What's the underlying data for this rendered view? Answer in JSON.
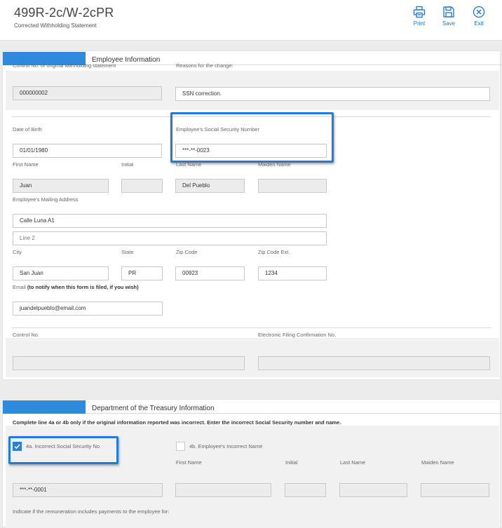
{
  "header": {
    "title": "499R-2c/W-2cPR",
    "subtitle": "Corrected Withholding Statement",
    "print_label": "Print",
    "save_label": "Save",
    "exit_label": "Exit"
  },
  "employee_section": {
    "title": "Employee Information",
    "control_no_original_label": "Control No. of original withholding statement",
    "control_no_original_value": "000000002",
    "reasons_label": "Reasons for the change:",
    "reasons_value": "SSN correction.",
    "dob_label": "Date of Birth",
    "dob_value": "01/01/1980",
    "ssn_label": "Employee's Social Security Number",
    "ssn_value": "***-**-0023",
    "first_name_label": "First Name",
    "first_name_value": "Juan",
    "initial_label": "Initial",
    "initial_value": "",
    "last_name_label": "Last Name",
    "last_name_value": "Del Pueblo",
    "maiden_name_label": "Maiden Name",
    "maiden_name_value": "",
    "mailing_address_label": "Employee's Mailing Address",
    "address_line1_value": "Calle Luna A1",
    "address_line2_placeholder": "Line 2",
    "city_label": "City",
    "city_value": "San Juan",
    "state_label": "State",
    "state_value": "PR",
    "zip_label": "Zip Code",
    "zip_value": "00923",
    "zip_ext_label": "Zip Code Ext.",
    "zip_ext_value": "1234",
    "email_label_prefix": "Email",
    "email_label_note": "(to notify when this form is filed, if you wish)",
    "email_value": "juandelpueblo@email.com",
    "control_no_label": "Control No.",
    "control_no_value": "",
    "efile_label": "Electronic Filing Confirmation No.",
    "efile_value": ""
  },
  "treasury_section": {
    "title": "Department of the Treasury Information",
    "instruction": "Complete line 4a or 4b only if the original information reported was incorrect. Enter the incorrect Social Security number and name.",
    "incorrect_ssn_label": "4a. Incorrect Social Security No.",
    "incorrect_ssn_checked": true,
    "incorrect_name_label": "4b. Employee's Incorrect Name",
    "incorrect_name_checked": false,
    "first_name_label": "First Name",
    "initial_label": "Initial",
    "last_name_label": "Last Name",
    "maiden_name_label": "Maiden Name",
    "incorrect_ssn_value": "***-**-0001",
    "remuneration_label": "Indicate if the remuneration includes payments to the employee for:"
  },
  "colors": {
    "accent": "#1a74c9",
    "tab_blue": "#2e8bdb",
    "highlight": "#1f7bdc"
  }
}
